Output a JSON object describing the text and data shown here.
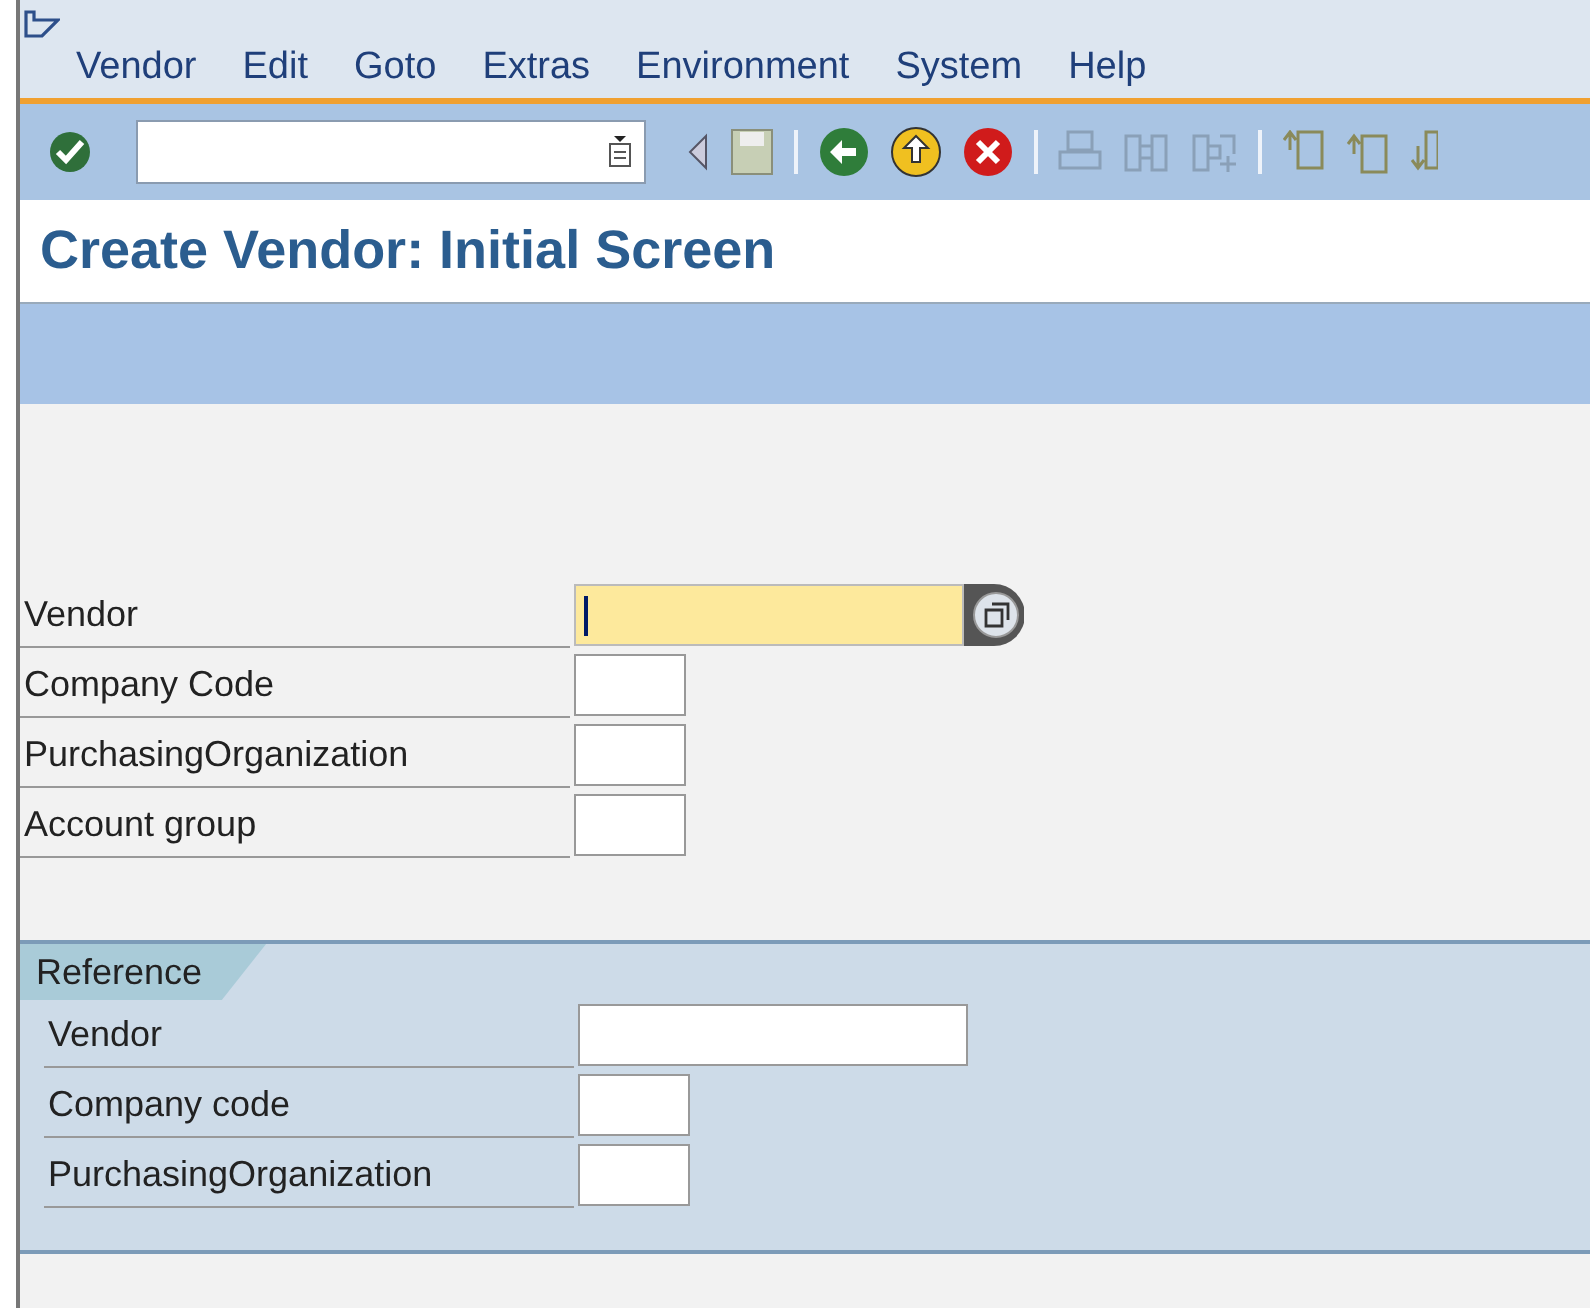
{
  "menu": [
    {
      "label": "Vendor"
    },
    {
      "label": "Edit"
    },
    {
      "label": "Goto"
    },
    {
      "label": "Extras"
    },
    {
      "label": "Environment"
    },
    {
      "label": "System"
    },
    {
      "label": "Help"
    }
  ],
  "title": "Create Vendor:  Initial Screen",
  "fields": [
    {
      "label": "Vendor",
      "kind": "wide",
      "focused": true,
      "help": true
    },
    {
      "label": "Company Code",
      "kind": "short",
      "focused": false,
      "help": false
    },
    {
      "label": "PurchasingOrganization",
      "kind": "short",
      "focused": false,
      "help": false
    },
    {
      "label": "Account group",
      "kind": "short",
      "focused": false,
      "help": false
    }
  ],
  "reference": {
    "title": "Reference",
    "fields": [
      {
        "label": "Vendor",
        "kind": "wide",
        "focused": false,
        "help": false
      },
      {
        "label": "Company code",
        "kind": "short",
        "focused": false,
        "help": false
      },
      {
        "label": "PurchasingOrganization",
        "kind": "short",
        "focused": false,
        "help": false
      }
    ]
  }
}
